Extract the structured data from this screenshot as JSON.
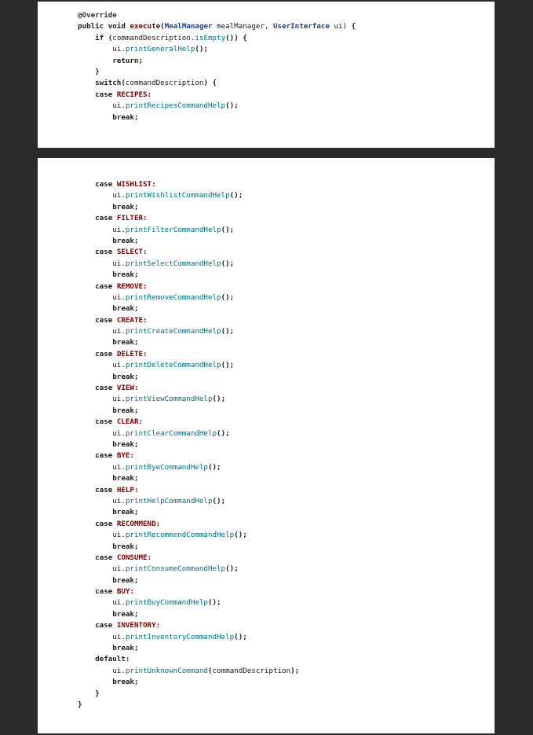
{
  "page1_lines": [
    [
      [
        "an",
        "@Override"
      ]
    ],
    [
      [
        "kw",
        "public "
      ],
      [
        "kw",
        "void "
      ],
      [
        "ex",
        "execute"
      ],
      [
        "kw",
        "("
      ],
      [
        "ty",
        "MealManager"
      ],
      [
        "tx",
        " mealManager, "
      ],
      [
        "ty",
        "UserInterface"
      ],
      [
        "tx",
        " ui) "
      ],
      [
        "kw",
        "{"
      ]
    ],
    [
      [
        "tx",
        "    "
      ],
      [
        "kw",
        "if "
      ],
      [
        "kw",
        "("
      ],
      [
        "tx",
        "commandDescription."
      ],
      [
        "fn",
        "isEmpty"
      ],
      [
        "kw",
        "()) {"
      ]
    ],
    [
      [
        "tx",
        "        ui."
      ],
      [
        "fn",
        "printGeneralHelp"
      ],
      [
        "kw",
        "();"
      ]
    ],
    [
      [
        "tx",
        "        "
      ],
      [
        "kw",
        "return;"
      ]
    ],
    [
      [
        "tx",
        "    "
      ],
      [
        "kw",
        "}"
      ]
    ],
    [
      [
        "tx",
        "    "
      ],
      [
        "kw",
        "switch("
      ],
      [
        "tx",
        "commandDescription"
      ],
      [
        "kw",
        ") {"
      ]
    ],
    [
      [
        "tx",
        "    "
      ],
      [
        "kw",
        "case "
      ],
      [
        "ex",
        "RECIPES:"
      ]
    ],
    [
      [
        "tx",
        "        ui."
      ],
      [
        "fn",
        "printRecipesCommandHelp"
      ],
      [
        "kw",
        "();"
      ]
    ],
    [
      [
        "tx",
        "        "
      ],
      [
        "kw",
        "break;"
      ]
    ]
  ],
  "page2_lines": [
    [
      [
        "tx",
        "    "
      ],
      [
        "kw",
        "case "
      ],
      [
        "ex",
        "WISHLIST:"
      ]
    ],
    [
      [
        "tx",
        "        ui."
      ],
      [
        "fn",
        "printWishlistCommandHelp"
      ],
      [
        "kw",
        "();"
      ]
    ],
    [
      [
        "tx",
        "        "
      ],
      [
        "kw",
        "break;"
      ]
    ],
    [
      [
        "tx",
        "    "
      ],
      [
        "kw",
        "case "
      ],
      [
        "ex",
        "FILTER:"
      ]
    ],
    [
      [
        "tx",
        "        ui."
      ],
      [
        "fn",
        "printFilterCommandHelp"
      ],
      [
        "kw",
        "();"
      ]
    ],
    [
      [
        "tx",
        "        "
      ],
      [
        "kw",
        "break;"
      ]
    ],
    [
      [
        "tx",
        "    "
      ],
      [
        "kw",
        "case "
      ],
      [
        "ex",
        "SELECT:"
      ]
    ],
    [
      [
        "tx",
        "        ui."
      ],
      [
        "fn",
        "printSelectCommandHelp"
      ],
      [
        "kw",
        "();"
      ]
    ],
    [
      [
        "tx",
        "        "
      ],
      [
        "kw",
        "break;"
      ]
    ],
    [
      [
        "tx",
        "    "
      ],
      [
        "kw",
        "case "
      ],
      [
        "ex",
        "REMOVE:"
      ]
    ],
    [
      [
        "tx",
        "        ui."
      ],
      [
        "fn",
        "printRemoveCommandHelp"
      ],
      [
        "kw",
        "();"
      ]
    ],
    [
      [
        "tx",
        "        "
      ],
      [
        "kw",
        "break;"
      ]
    ],
    [
      [
        "tx",
        "    "
      ],
      [
        "kw",
        "case "
      ],
      [
        "ex",
        "CREATE:"
      ]
    ],
    [
      [
        "tx",
        "        ui."
      ],
      [
        "fn",
        "printCreateCommandHelp"
      ],
      [
        "kw",
        "();"
      ]
    ],
    [
      [
        "tx",
        "        "
      ],
      [
        "kw",
        "break;"
      ]
    ],
    [
      [
        "tx",
        "    "
      ],
      [
        "kw",
        "case "
      ],
      [
        "ex",
        "DELETE:"
      ]
    ],
    [
      [
        "tx",
        "        ui."
      ],
      [
        "fn",
        "printDeleteCommandHelp"
      ],
      [
        "kw",
        "();"
      ]
    ],
    [
      [
        "tx",
        "        "
      ],
      [
        "kw",
        "break;"
      ]
    ],
    [
      [
        "tx",
        "    "
      ],
      [
        "kw",
        "case "
      ],
      [
        "ex",
        "VIEW:"
      ]
    ],
    [
      [
        "tx",
        "        ui."
      ],
      [
        "fn",
        "printViewCommandHelp"
      ],
      [
        "kw",
        "();"
      ]
    ],
    [
      [
        "tx",
        "        "
      ],
      [
        "kw",
        "break;"
      ]
    ],
    [
      [
        "tx",
        "    "
      ],
      [
        "kw",
        "case "
      ],
      [
        "ex",
        "CLEAR:"
      ]
    ],
    [
      [
        "tx",
        "        ui."
      ],
      [
        "fn",
        "printClearCommandHelp"
      ],
      [
        "kw",
        "();"
      ]
    ],
    [
      [
        "tx",
        "        "
      ],
      [
        "kw",
        "break;"
      ]
    ],
    [
      [
        "tx",
        "    "
      ],
      [
        "kw",
        "case "
      ],
      [
        "ex",
        "BYE:"
      ]
    ],
    [
      [
        "tx",
        "        ui."
      ],
      [
        "fn",
        "printByeCommandHelp"
      ],
      [
        "kw",
        "();"
      ]
    ],
    [
      [
        "tx",
        "        "
      ],
      [
        "kw",
        "break;"
      ]
    ],
    [
      [
        "tx",
        "    "
      ],
      [
        "kw",
        "case "
      ],
      [
        "ex",
        "HELP:"
      ]
    ],
    [
      [
        "tx",
        "        ui."
      ],
      [
        "fn",
        "printHelpCommandHelp"
      ],
      [
        "kw",
        "();"
      ]
    ],
    [
      [
        "tx",
        "        "
      ],
      [
        "kw",
        "break;"
      ]
    ],
    [
      [
        "tx",
        "    "
      ],
      [
        "kw",
        "case "
      ],
      [
        "ex",
        "RECOMMEND:"
      ]
    ],
    [
      [
        "tx",
        "        ui."
      ],
      [
        "fn",
        "printRecommendCommandHelp"
      ],
      [
        "kw",
        "();"
      ]
    ],
    [
      [
        "tx",
        "        "
      ],
      [
        "kw",
        "break;"
      ]
    ],
    [
      [
        "tx",
        "    "
      ],
      [
        "kw",
        "case "
      ],
      [
        "ex",
        "CONSUME:"
      ]
    ],
    [
      [
        "tx",
        "        ui."
      ],
      [
        "fn",
        "printConsumeCommandHelp"
      ],
      [
        "kw",
        "();"
      ]
    ],
    [
      [
        "tx",
        "        "
      ],
      [
        "kw",
        "break;"
      ]
    ],
    [
      [
        "tx",
        "    "
      ],
      [
        "kw",
        "case "
      ],
      [
        "ex",
        "BUY:"
      ]
    ],
    [
      [
        "tx",
        "        ui."
      ],
      [
        "fn",
        "printBuyCommandHelp"
      ],
      [
        "kw",
        "();"
      ]
    ],
    [
      [
        "tx",
        "        "
      ],
      [
        "kw",
        "break;"
      ]
    ],
    [
      [
        "tx",
        "    "
      ],
      [
        "kw",
        "case "
      ],
      [
        "ex",
        "INVENTORY:"
      ]
    ],
    [
      [
        "tx",
        "        ui."
      ],
      [
        "fn",
        "printInventoryCommandHelp"
      ],
      [
        "kw",
        "();"
      ]
    ],
    [
      [
        "tx",
        "        "
      ],
      [
        "kw",
        "break;"
      ]
    ],
    [
      [
        "tx",
        "    "
      ],
      [
        "kw",
        "default:"
      ]
    ],
    [
      [
        "tx",
        "        ui."
      ],
      [
        "fn",
        "printUnknownCommand"
      ],
      [
        "kw",
        "("
      ],
      [
        "tx",
        "commandDescription"
      ],
      [
        "kw",
        ");"
      ]
    ],
    [
      [
        "tx",
        "        "
      ],
      [
        "kw",
        "break;"
      ]
    ],
    [
      [
        "tx",
        "    "
      ],
      [
        "kw",
        "}"
      ]
    ],
    [
      [
        "kw",
        "}"
      ]
    ]
  ]
}
